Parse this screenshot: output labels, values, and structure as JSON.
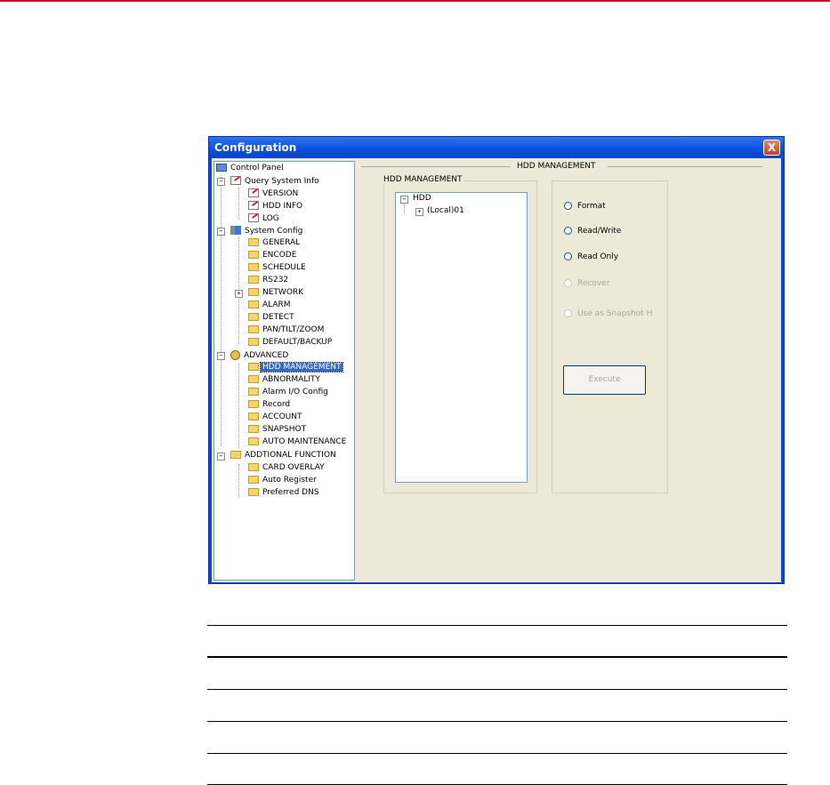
{
  "window": {
    "title": "Configuration",
    "close_label": "X"
  },
  "tree": {
    "items": [
      {
        "label": "Control Panel"
      },
      {
        "label": "Query System Info"
      },
      {
        "label": "VERSION"
      },
      {
        "label": "HDD INFO"
      },
      {
        "label": "LOG"
      },
      {
        "label": "System Config"
      },
      {
        "label": "GENERAL"
      },
      {
        "label": "ENCODE"
      },
      {
        "label": "SCHEDULE"
      },
      {
        "label": "RS232"
      },
      {
        "label": "NETWORK"
      },
      {
        "label": "ALARM"
      },
      {
        "label": "DETECT"
      },
      {
        "label": "PAN/TILT/ZOOM"
      },
      {
        "label": "DEFAULT/BACKUP"
      },
      {
        "label": "ADVANCED"
      },
      {
        "label": "HDD MANAGEMENT"
      },
      {
        "label": "ABNORMALITY"
      },
      {
        "label": "Alarm I/O Config"
      },
      {
        "label": "Record"
      },
      {
        "label": "ACCOUNT"
      },
      {
        "label": "SNAPSHOT"
      },
      {
        "label": "AUTO MAINTENANCE"
      },
      {
        "label": "ADDTIONAL FUNCTION"
      },
      {
        "label": "CARD OVERLAY"
      },
      {
        "label": "Auto Register"
      },
      {
        "label": "Preferred DNS"
      }
    ],
    "selected": "HDD MANAGEMENT"
  },
  "panel": {
    "heading": "HDD MANAGEMENT",
    "group_title": "HDD MANAGEMENT",
    "hdd_tree": {
      "root": "HDD",
      "child": "(Local)01",
      "collapse_glyph": "−",
      "expand_glyph": "+"
    },
    "options": {
      "format": "Format",
      "read_write": "Read/Write",
      "read_only": "Read Only",
      "recover": "Recover",
      "snapshot": "Use as Snapshot H"
    },
    "execute_label": "Execute"
  },
  "tree_glyphs": {
    "collapse": "−",
    "expand": "+"
  }
}
